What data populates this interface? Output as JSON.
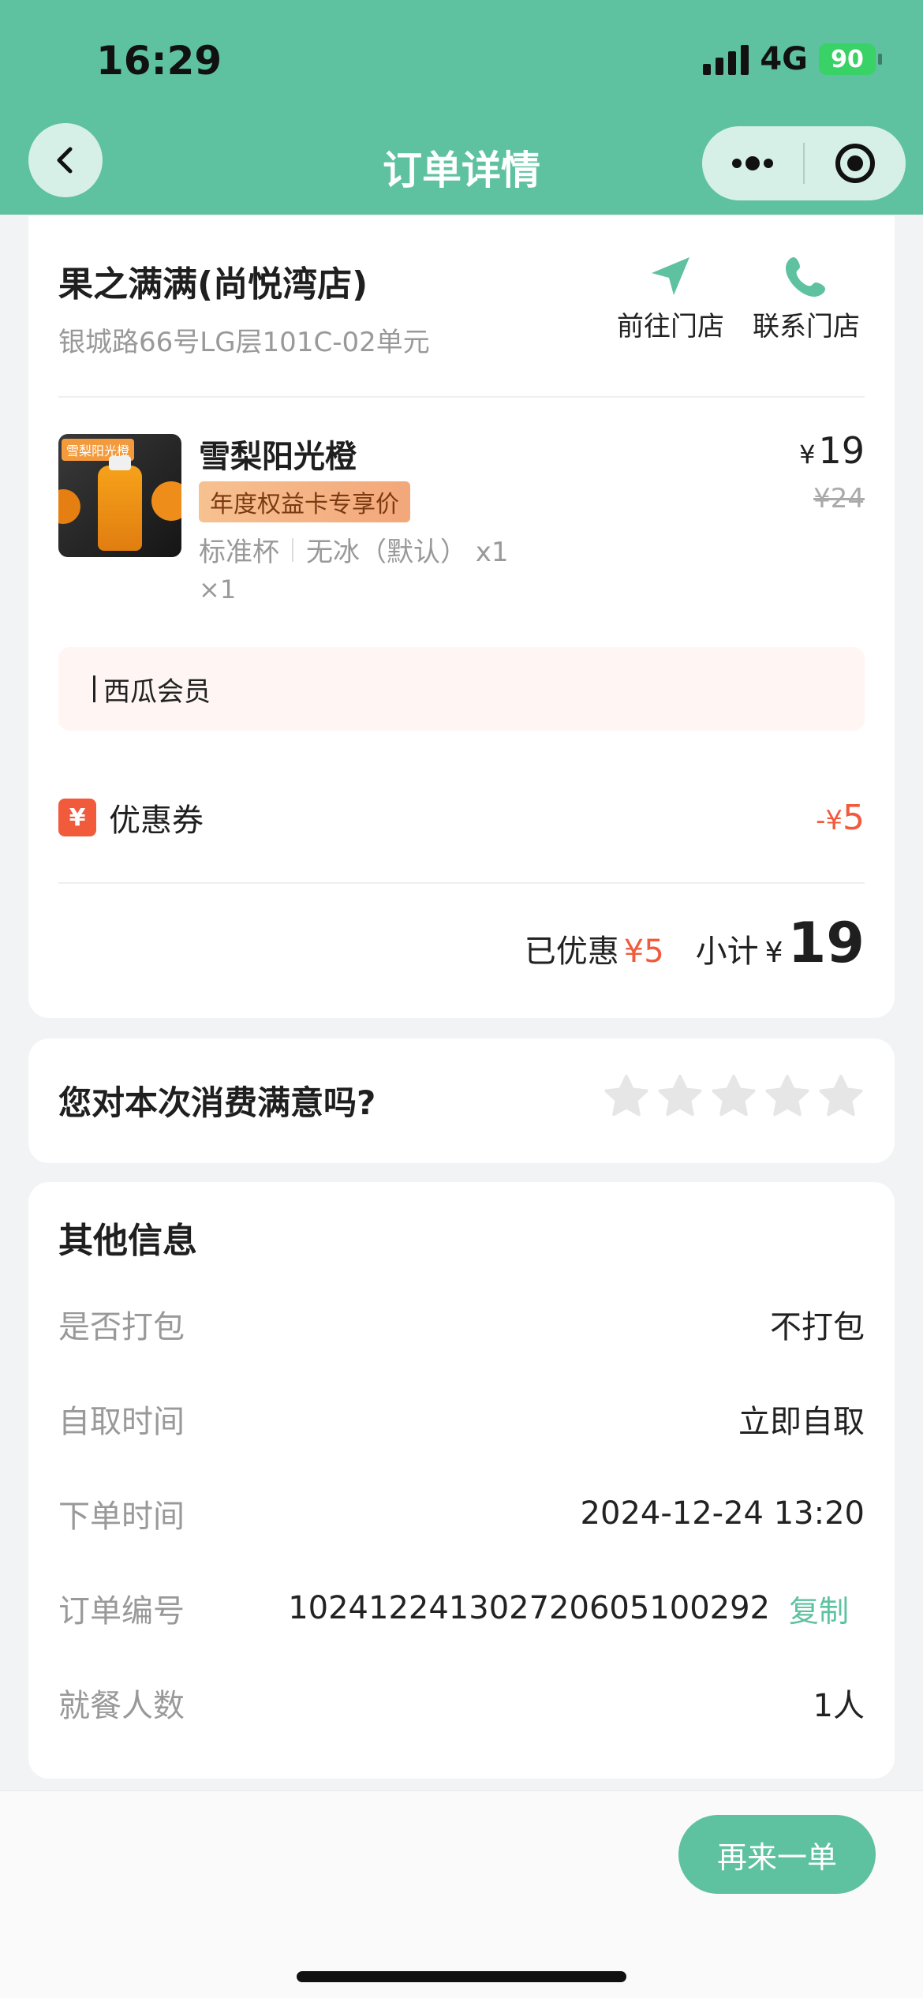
{
  "status": {
    "time": "16:29",
    "network": "4G",
    "battery": "90"
  },
  "nav": {
    "title": "订单详情"
  },
  "store": {
    "name": "果之满满(尚悦湾店)",
    "address": "银城路66号LG层101C-02单元",
    "go_label": "前往门店",
    "call_label": "联系门店"
  },
  "product": {
    "image_text": "雪梨阳光橙",
    "name": "雪梨阳光橙",
    "tag": "年度权益卡专享价",
    "size": "标准杯",
    "ice": "无冰（默认） x1",
    "qty": "×1",
    "currency": "¥",
    "price": "19",
    "original_price": "¥24"
  },
  "member": {
    "label": "西瓜会员"
  },
  "coupon": {
    "label": "优惠券",
    "icon": "¥",
    "value_prefix": "-¥",
    "value": "5"
  },
  "summary": {
    "discount_label": "已优惠",
    "discount_value": "¥5",
    "subtotal_label": "小计",
    "currency": "¥",
    "subtotal_value": "19"
  },
  "rating": {
    "question": "您对本次消费满意吗?",
    "stars": 0,
    "max_stars": 5
  },
  "other": {
    "title": "其他信息",
    "rows": [
      {
        "key": "是否打包",
        "value": "不打包"
      },
      {
        "key": "自取时间",
        "value": "立即自取"
      },
      {
        "key": "下单时间",
        "value": "2024-12-24 13:20"
      },
      {
        "key": "订单编号",
        "value": "1024122413027206051002​92",
        "copy": "复制"
      },
      {
        "key": "就餐人数",
        "value": "1人"
      }
    ]
  },
  "footer": {
    "reorder_label": "再来一单"
  },
  "colors": {
    "brand": "#5ec1a0",
    "accent": "#f25a3c",
    "tag": "#f3a77a"
  }
}
